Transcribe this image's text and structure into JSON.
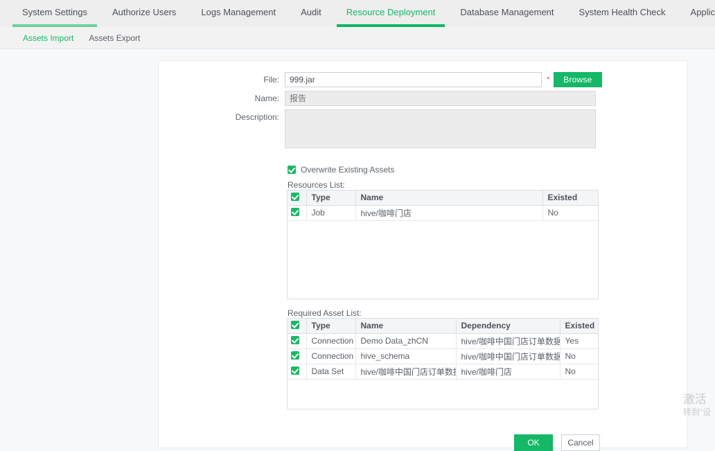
{
  "topnav": {
    "items": [
      {
        "label": "System Settings",
        "state": "hover"
      },
      {
        "label": "Authorize Users",
        "state": "normal"
      },
      {
        "label": "Logs Management",
        "state": "normal"
      },
      {
        "label": "Audit",
        "state": "normal"
      },
      {
        "label": "Resource Deployment",
        "state": "active"
      },
      {
        "label": "Database Management",
        "state": "normal"
      },
      {
        "label": "System Health Check",
        "state": "normal"
      },
      {
        "label": "Application Management",
        "state": "normal"
      }
    ]
  },
  "subnav": {
    "items": [
      {
        "label": "Assets Import",
        "state": "active"
      },
      {
        "label": "Assets Export",
        "state": "normal"
      }
    ]
  },
  "form": {
    "file": {
      "label": "File:",
      "value": "999.jar",
      "placeholder": "",
      "required_mark": "*",
      "browse_label": "Browse"
    },
    "name": {
      "label": "Name:",
      "value": "",
      "placeholder": "报告"
    },
    "description": {
      "label": "Description:",
      "value": "",
      "placeholder": ""
    },
    "overwrite": {
      "label": "Overwrite Existing Assets",
      "checked": true
    }
  },
  "resources_list": {
    "label": "Resources List:",
    "header_checkbox_checked": true,
    "columns": [
      "",
      "Type",
      "Name",
      "Existed"
    ],
    "rows": [
      {
        "checked": true,
        "type": "Job",
        "name": "hive/咖啡门店",
        "existed": "No"
      }
    ]
  },
  "required_asset_list": {
    "label": "Required Asset List:",
    "header_checkbox_checked": true,
    "columns": [
      "",
      "Type",
      "Name",
      "Dependency",
      "Existed"
    ],
    "rows": [
      {
        "checked": true,
        "type": "Connection",
        "name": "Demo Data_zhCN",
        "dependency": "hive/咖啡中国门店订单数据",
        "existed": "Yes"
      },
      {
        "checked": true,
        "type": "Connection",
        "name": "hive_schema",
        "dependency": "hive/咖啡中国门店订单数据, hive/咖啡门店",
        "existed": "No"
      },
      {
        "checked": true,
        "type": "Data Set",
        "name": "hive/咖啡中国门店订单数据",
        "dependency": "hive/咖啡门店",
        "existed": "No"
      }
    ]
  },
  "footer": {
    "ok_label": "OK",
    "cancel_label": "Cancel"
  },
  "watermark": {
    "line1": "激活",
    "line2": "转到\"设"
  },
  "colors": {
    "accent_green": "#14b866",
    "hover_green": "#6fcf9c",
    "required_red": "#e8543f",
    "page_bg": "#f7f8fa",
    "nav_bg": "#eeeeee"
  }
}
